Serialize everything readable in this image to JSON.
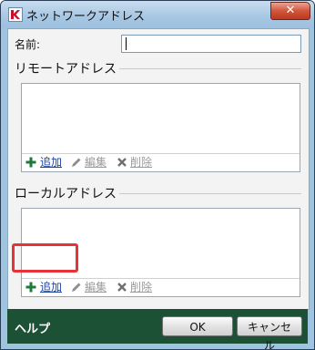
{
  "window": {
    "title": "ネットワークアドレス",
    "close_label": "✕"
  },
  "form": {
    "name_label": "名前:",
    "name_value": ""
  },
  "remote": {
    "group_title": "リモートアドレス",
    "add_label": "追加",
    "edit_label": "編集",
    "delete_label": "削除"
  },
  "local": {
    "group_title": "ローカルアドレス",
    "add_label": "追加",
    "edit_label": "編集",
    "delete_label": "削除"
  },
  "footer": {
    "help_label": "ヘルプ",
    "ok_label": "OK",
    "cancel_label": "キャンセル"
  },
  "colors": {
    "footer_bg": "#1c5136",
    "highlight": "#e8323a",
    "add_icon": "#1e7a3a",
    "link": "#1a43a8"
  },
  "icons": {
    "app": "kaspersky-k-icon",
    "add": "plus-icon",
    "edit": "pencil-icon",
    "delete": "x-icon",
    "close": "close-icon"
  }
}
